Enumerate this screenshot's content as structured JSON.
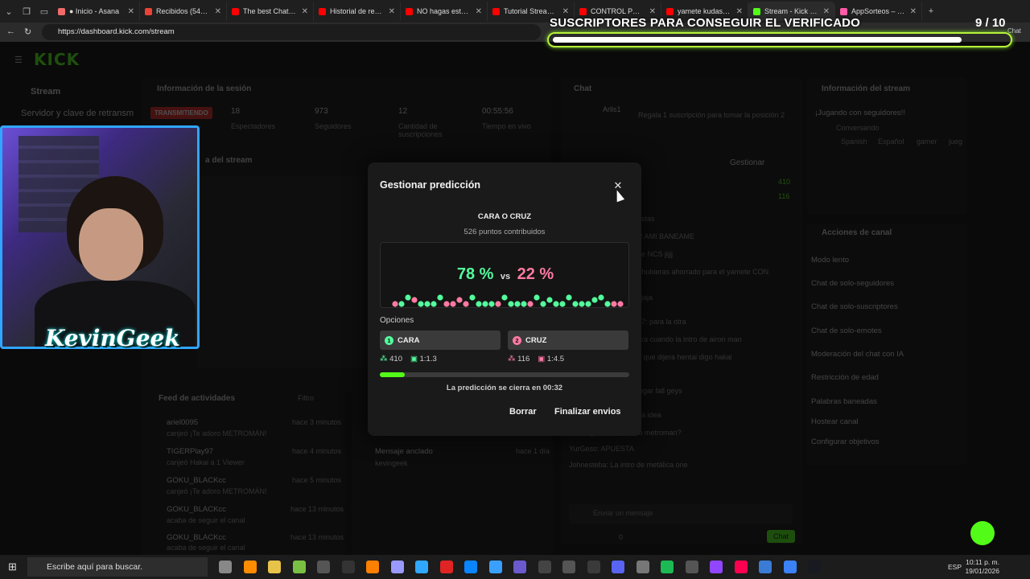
{
  "browser": {
    "tabs": [
      {
        "title": "● Inicio - Asana",
        "color": "#f06a6a"
      },
      {
        "title": "Recibidos (547) - ke",
        "color": "#ea4335"
      },
      {
        "title": "The best ChatBot a",
        "color": "#ff0000"
      },
      {
        "title": "Historial de reprodu",
        "color": "#ff0000"
      },
      {
        "title": "NO hagas esto des",
        "color": "#ff0000"
      },
      {
        "title": "Tutorial Streamer b",
        "color": "#ff0000"
      },
      {
        "title": "CONTROL POR VOZ",
        "color": "#ff0000"
      },
      {
        "title": "yamete kudasai - Yo",
        "color": "#ff0000"
      },
      {
        "title": "Stream - Kick Dash",
        "color": "#53fc18"
      },
      {
        "title": "AppSorteos – Cara",
        "color": "#ff5aa5"
      }
    ],
    "url": "https://dashboard.kick.com/stream",
    "extra_label": "Chat"
  },
  "overlay": {
    "title": "SUSCRIPTORES PARA CONSEGUIR EL VERIFICADO",
    "count": "9  / 10",
    "progress": 0.9
  },
  "dashboard": {
    "logo": "KICK",
    "sidebar_title": "Stream",
    "sidebar_item": "Servidor y clave de retransm",
    "session_title": "Información de la sesión",
    "live_badge": "TRANSMITIENDO",
    "stats": [
      {
        "value": "18",
        "label": "Espectadores"
      },
      {
        "value": "973",
        "label": "Seguidores"
      },
      {
        "value": "12",
        "label": "Cantidad de suscripciones"
      },
      {
        "value": "00:55:56",
        "label": "Tiempo en vivo"
      }
    ],
    "preview_title": "a del stream",
    "chat_title": "Chat",
    "chat_top_user": "Arlis1",
    "chat_top_note": "Regala 1 suscripción para tomar la posición 2",
    "chat_manage": "Gestionar",
    "chat_points": [
      "410",
      "116"
    ],
    "chat_lines": [
      "estas",
      "R AMI BANEAME",
      "de NCS jijjj",
      "r hubieras ahorrado para el yamete CON",
      "ajaja",
      "97: para la otra",
      "ara cuando la intro de airon man",
      "o que dijera hentai digo hakai",
      "jugar fall geys",
      "na idea",
      "GOKU_BLACKcc: Oso metroman?",
      "YurGeso: APUESTA",
      "Johnesteba: La intro de metálica one"
    ],
    "chat_input_placeholder": "Enviar un mensaje",
    "chat_send": "Chat",
    "chat_count": "0",
    "stream_info_title": "Información del stream",
    "stream_info_name": "¡Jugando con seguidores!!",
    "stream_info_category": "Conversando",
    "stream_info_tags": [
      "Spanish",
      "Español",
      "gamer",
      "jueg"
    ],
    "channel_actions_title": "Acciones de canal",
    "channel_actions": [
      "Modo lento",
      "Chat de solo-seguidores",
      "Chat de solo-suscriptores",
      "Chat de solo-emotes",
      "Moderación del chat con IA",
      "Restricción de edad",
      "Palabras baneadas",
      "Hostear canal",
      "Configurar objetivos"
    ],
    "activity_title": "Feed de actividades",
    "activity_filter": "Filtro",
    "activity": [
      {
        "user": "ariel0095",
        "text": "canjeó ¡Te adoro METROMÁN!",
        "time": "hace 3 minutos"
      },
      {
        "user": "TIGERPlay97",
        "text": "canjeó Hakai a 1 Viewer",
        "time": "hace 4 minutos"
      },
      {
        "user": "GOKU_BLACKcc",
        "text": "canjeó ¡Te adoro METROMÁN!",
        "time": "hace 5 minutos"
      },
      {
        "user": "GOKU_BLACKcc",
        "text": "acaba de seguir el canal",
        "time": "hace 13 minutos"
      },
      {
        "user": "GOKU_BLACKcc",
        "text": "acaba de seguir el canal",
        "time": "hace 13 minutos"
      }
    ],
    "pinned_title": "Mensaje anclado",
    "pinned_user": "kevingeek",
    "pinned_time": "hace 1 día"
  },
  "modal": {
    "title": "Gestionar predicción",
    "question": "CARA O CRUZ",
    "points": "526 puntos contribuidos",
    "pct_a": "78 %",
    "vs": "vs",
    "pct_b": "22 %",
    "options_label": "Opciones",
    "option_a": {
      "num": "1",
      "label": "CARA",
      "points": "410",
      "ratio": "1:1.3",
      "color": "#53fc9c"
    },
    "option_b": {
      "num": "2",
      "label": "CRUZ",
      "points": "116",
      "ratio": "1:4.5",
      "color": "#ff7aa2"
    },
    "progress": 0.1,
    "close_note": "La predicción se cierra en 00:32",
    "delete_label": "Borrar",
    "finish_label": "Finalizar envios"
  },
  "webcam": {
    "brand": "KevinGeek"
  },
  "taskbar": {
    "search_placeholder": "Escribe aquí para buscar.",
    "lang": "ESP",
    "time": "10:11 p. m.",
    "date": "19/01/2026"
  }
}
